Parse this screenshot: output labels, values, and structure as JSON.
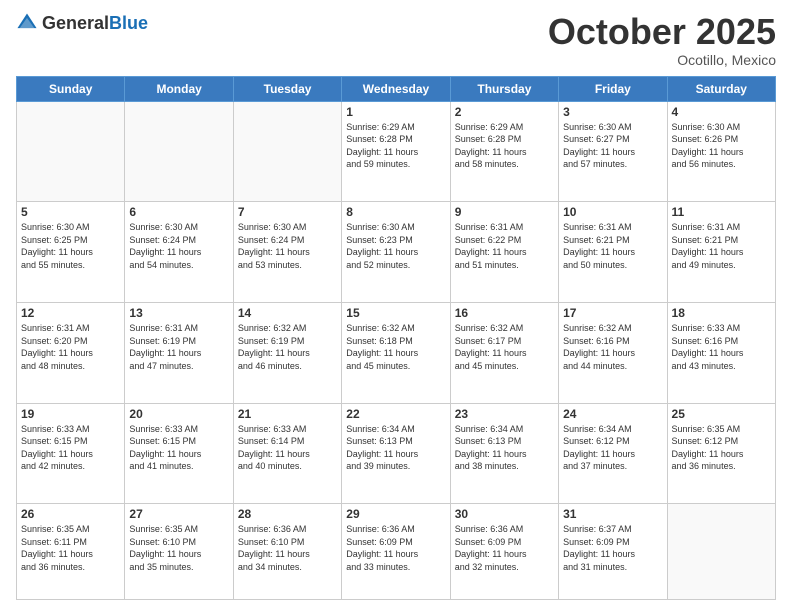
{
  "header": {
    "logo_general": "General",
    "logo_blue": "Blue",
    "month": "October 2025",
    "location": "Ocotillo, Mexico"
  },
  "weekdays": [
    "Sunday",
    "Monday",
    "Tuesday",
    "Wednesday",
    "Thursday",
    "Friday",
    "Saturday"
  ],
  "weeks": [
    [
      {
        "day": "",
        "info": ""
      },
      {
        "day": "",
        "info": ""
      },
      {
        "day": "",
        "info": ""
      },
      {
        "day": "1",
        "info": "Sunrise: 6:29 AM\nSunset: 6:28 PM\nDaylight: 11 hours\nand 59 minutes."
      },
      {
        "day": "2",
        "info": "Sunrise: 6:29 AM\nSunset: 6:28 PM\nDaylight: 11 hours\nand 58 minutes."
      },
      {
        "day": "3",
        "info": "Sunrise: 6:30 AM\nSunset: 6:27 PM\nDaylight: 11 hours\nand 57 minutes."
      },
      {
        "day": "4",
        "info": "Sunrise: 6:30 AM\nSunset: 6:26 PM\nDaylight: 11 hours\nand 56 minutes."
      }
    ],
    [
      {
        "day": "5",
        "info": "Sunrise: 6:30 AM\nSunset: 6:25 PM\nDaylight: 11 hours\nand 55 minutes."
      },
      {
        "day": "6",
        "info": "Sunrise: 6:30 AM\nSunset: 6:24 PM\nDaylight: 11 hours\nand 54 minutes."
      },
      {
        "day": "7",
        "info": "Sunrise: 6:30 AM\nSunset: 6:24 PM\nDaylight: 11 hours\nand 53 minutes."
      },
      {
        "day": "8",
        "info": "Sunrise: 6:30 AM\nSunset: 6:23 PM\nDaylight: 11 hours\nand 52 minutes."
      },
      {
        "day": "9",
        "info": "Sunrise: 6:31 AM\nSunset: 6:22 PM\nDaylight: 11 hours\nand 51 minutes."
      },
      {
        "day": "10",
        "info": "Sunrise: 6:31 AM\nSunset: 6:21 PM\nDaylight: 11 hours\nand 50 minutes."
      },
      {
        "day": "11",
        "info": "Sunrise: 6:31 AM\nSunset: 6:21 PM\nDaylight: 11 hours\nand 49 minutes."
      }
    ],
    [
      {
        "day": "12",
        "info": "Sunrise: 6:31 AM\nSunset: 6:20 PM\nDaylight: 11 hours\nand 48 minutes."
      },
      {
        "day": "13",
        "info": "Sunrise: 6:31 AM\nSunset: 6:19 PM\nDaylight: 11 hours\nand 47 minutes."
      },
      {
        "day": "14",
        "info": "Sunrise: 6:32 AM\nSunset: 6:19 PM\nDaylight: 11 hours\nand 46 minutes."
      },
      {
        "day": "15",
        "info": "Sunrise: 6:32 AM\nSunset: 6:18 PM\nDaylight: 11 hours\nand 45 minutes."
      },
      {
        "day": "16",
        "info": "Sunrise: 6:32 AM\nSunset: 6:17 PM\nDaylight: 11 hours\nand 45 minutes."
      },
      {
        "day": "17",
        "info": "Sunrise: 6:32 AM\nSunset: 6:16 PM\nDaylight: 11 hours\nand 44 minutes."
      },
      {
        "day": "18",
        "info": "Sunrise: 6:33 AM\nSunset: 6:16 PM\nDaylight: 11 hours\nand 43 minutes."
      }
    ],
    [
      {
        "day": "19",
        "info": "Sunrise: 6:33 AM\nSunset: 6:15 PM\nDaylight: 11 hours\nand 42 minutes."
      },
      {
        "day": "20",
        "info": "Sunrise: 6:33 AM\nSunset: 6:15 PM\nDaylight: 11 hours\nand 41 minutes."
      },
      {
        "day": "21",
        "info": "Sunrise: 6:33 AM\nSunset: 6:14 PM\nDaylight: 11 hours\nand 40 minutes."
      },
      {
        "day": "22",
        "info": "Sunrise: 6:34 AM\nSunset: 6:13 PM\nDaylight: 11 hours\nand 39 minutes."
      },
      {
        "day": "23",
        "info": "Sunrise: 6:34 AM\nSunset: 6:13 PM\nDaylight: 11 hours\nand 38 minutes."
      },
      {
        "day": "24",
        "info": "Sunrise: 6:34 AM\nSunset: 6:12 PM\nDaylight: 11 hours\nand 37 minutes."
      },
      {
        "day": "25",
        "info": "Sunrise: 6:35 AM\nSunset: 6:12 PM\nDaylight: 11 hours\nand 36 minutes."
      }
    ],
    [
      {
        "day": "26",
        "info": "Sunrise: 6:35 AM\nSunset: 6:11 PM\nDaylight: 11 hours\nand 36 minutes."
      },
      {
        "day": "27",
        "info": "Sunrise: 6:35 AM\nSunset: 6:10 PM\nDaylight: 11 hours\nand 35 minutes."
      },
      {
        "day": "28",
        "info": "Sunrise: 6:36 AM\nSunset: 6:10 PM\nDaylight: 11 hours\nand 34 minutes."
      },
      {
        "day": "29",
        "info": "Sunrise: 6:36 AM\nSunset: 6:09 PM\nDaylight: 11 hours\nand 33 minutes."
      },
      {
        "day": "30",
        "info": "Sunrise: 6:36 AM\nSunset: 6:09 PM\nDaylight: 11 hours\nand 32 minutes."
      },
      {
        "day": "31",
        "info": "Sunrise: 6:37 AM\nSunset: 6:09 PM\nDaylight: 11 hours\nand 31 minutes."
      },
      {
        "day": "",
        "info": ""
      }
    ]
  ]
}
